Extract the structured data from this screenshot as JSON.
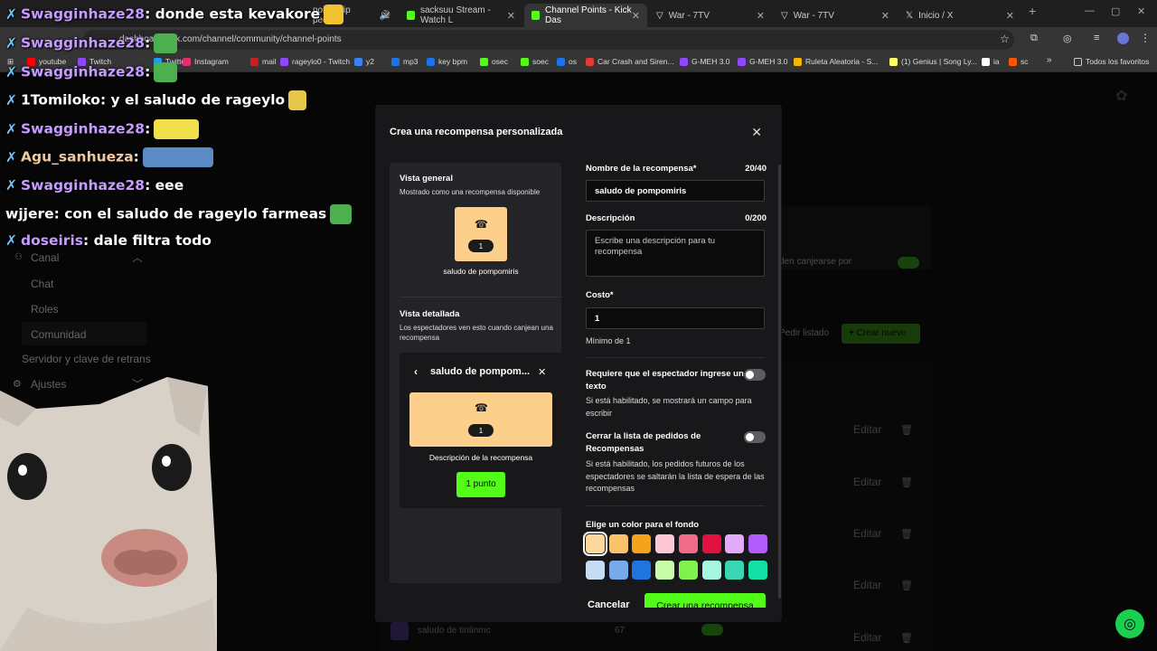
{
  "browser": {
    "tabs": [
      {
        "label": "point! (rip peep)",
        "kind": "kick"
      },
      {
        "label": "sacksuu Stream - Watch L",
        "kind": "kick"
      },
      {
        "label": "Channel Points - Kick Das",
        "kind": "kick",
        "active": true
      },
      {
        "label": "War - 7TV",
        "kind": "7tv"
      },
      {
        "label": "War - 7TV",
        "kind": "7tv"
      },
      {
        "label": "Inicio / X",
        "kind": "x"
      }
    ],
    "new_tab": "+",
    "url": "dashboard.kick.com/channel/community/channel-points",
    "bookmarks": [
      {
        "label": "youtube",
        "color": "#ff0000"
      },
      {
        "label": "Twitch",
        "color": "#9146ff"
      },
      {
        "label": "Twitter",
        "color": "#1d9bf0"
      },
      {
        "label": "Instagram",
        "color": "#e1306c"
      },
      {
        "label": "mail",
        "color": "#c5221f"
      },
      {
        "label": "rageylo0 - Twitch",
        "color": "#9146ff"
      },
      {
        "label": "y2",
        "color": "#3b82f6"
      },
      {
        "label": "mp3",
        "color": "#1a73e8"
      },
      {
        "label": "key bpm",
        "color": "#1a73e8"
      },
      {
        "label": "osec",
        "color": "#53fc18"
      },
      {
        "label": "soec",
        "color": "#53fc18"
      },
      {
        "label": "os",
        "color": "#1a73e8"
      },
      {
        "label": "Car Crash and Siren...",
        "color": "#e53935"
      },
      {
        "label": "G-MEH 3.0",
        "color": "#9146ff"
      },
      {
        "label": "G-MEH 3.0",
        "color": "#9146ff"
      },
      {
        "label": "Ruleta Aleatoria - S...",
        "color": "#f4b400"
      },
      {
        "label": "(1) Genius | Song Ly...",
        "color": "#ffff64"
      },
      {
        "label": "ia",
        "color": "#ffffff"
      },
      {
        "label": "sc",
        "color": "#ff5500"
      }
    ],
    "bookmarks_more": "»",
    "all_bookmarks": "Todos los favoritos"
  },
  "background": {
    "sidebar": {
      "canal": "Canal",
      "chat": "Chat",
      "roles": "Roles",
      "comunidad": "Comunidad",
      "servidor": "Servidor y clave de retrans",
      "ajustes": "Ajustes"
    },
    "toggle_text": "den canjearse por",
    "pedir_listado": "Pedir listado",
    "crear_nuevo": "Crear nuevo",
    "edit_label": "Editar",
    "last_row": {
      "name": "saludo de tintinmc",
      "cost": "67"
    }
  },
  "modal": {
    "title": "Crea una recompensa personalizada",
    "preview": {
      "overview_title": "Vista general",
      "overview_sub": "Mostrado como una recompensa disponible",
      "card_cost": "1",
      "card_name": "saludo de pompomiris",
      "detail_title": "Vista detallada",
      "detail_sub": "Los espectadores ven esto cuando canjean una recompensa",
      "detail_header": "saludo de pompom...",
      "detail_cost": "1",
      "detail_desc": "Descripción de la recompensa",
      "detail_button": "1 punto"
    },
    "form": {
      "name_label": "Nombre de la recompensa*",
      "name_count": "20/40",
      "name_value": "saludo de pompomiris",
      "desc_label": "Descripción",
      "desc_count": "0/200",
      "desc_placeholder": "Escribe una descripción para tu recompensa",
      "cost_label": "Costo*",
      "cost_value": "1",
      "cost_min": "Mínimo de 1",
      "text_toggle_label": "Requiere que el espectador ingrese un texto",
      "text_toggle_help": "Si está habilitado, se mostrará un campo para escribir",
      "text_toggle_on": false,
      "queue_toggle_label": "Cerrar la lista de pedidos de Recompensas",
      "queue_toggle_help": "Si está habilitado, los pedidos futuros de los espectadores se saltarán la lista de espera de las recompensas",
      "queue_toggle_on": false,
      "color_label": "Elige un color para el fondo",
      "colors": [
        "#fcd89c",
        "#fbc26b",
        "#f7a21b",
        "#fcc7d4",
        "#f06b8a",
        "#e0103f",
        "#e3aaf9",
        "#b15bfb",
        "#c5dcf7",
        "#78a9ea",
        "#1f74e0",
        "#c6fcaa",
        "#7ff24d",
        "#a6f5e0",
        "#3ad6b3",
        "#13e0a4"
      ],
      "selected_color": 0
    },
    "cancel": "Cancelar",
    "submit": "Crear una recompensa"
  },
  "chat_overlay": [
    {
      "name": "Swagginhaze28",
      "message": ": donde esta kevakore"
    },
    {
      "name": "Swagginhaze28",
      "message": ":"
    },
    {
      "name": "Swagginhaze28",
      "message": ":"
    },
    {
      "name": "Tomiloko",
      "message": ": y el saludo de rageylo",
      "prefix": "1"
    },
    {
      "name": "Swagginhaze28",
      "message": ":"
    },
    {
      "name": "Agu_sanhueza",
      "message": ":"
    },
    {
      "name": "Swagginhaze28",
      "message": ": eee"
    },
    {
      "name": "wjjere",
      "message": ": con el saludo de rageylo farmeas"
    },
    {
      "name": "doseiris",
      "message": ": dale filtra todo"
    }
  ]
}
